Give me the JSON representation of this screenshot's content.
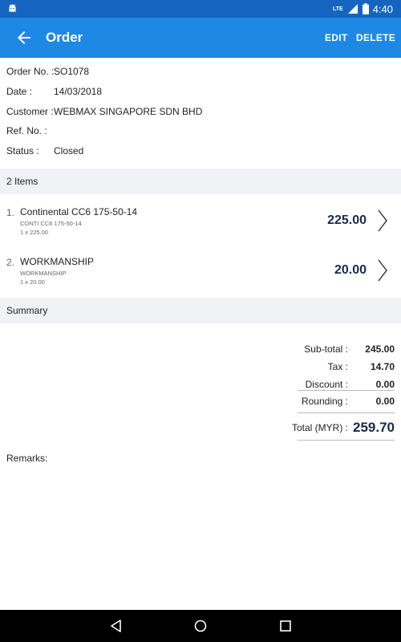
{
  "status_bar": {
    "network": "LTE",
    "time": "4:40"
  },
  "app_bar": {
    "title": "Order",
    "edit_label": "EDIT",
    "delete_label": "DELETE"
  },
  "order": {
    "fields": [
      {
        "label": "Order No. :",
        "value": "SO1078"
      },
      {
        "label": "Date :",
        "value": "14/03/2018"
      },
      {
        "label": "Customer :",
        "value": "WEBMAX SINGAPORE SDN BHD"
      },
      {
        "label": "Ref. No. :",
        "value": ""
      },
      {
        "label": "Status :",
        "value": "Closed"
      }
    ]
  },
  "items_header": "2 Items",
  "items": [
    {
      "index": "1.",
      "name": "Continental CC6 175-50-14",
      "code": "CONTI CC6 175-50-14",
      "qty_price": "1 x 225.00",
      "amount": "225.00"
    },
    {
      "index": "2.",
      "name": "WORKMANSHIP",
      "code": "WORKMANSHIP",
      "qty_price": "1 x 20.00",
      "amount": "20.00"
    }
  ],
  "summary_header": "Summary",
  "summary": {
    "subtotal_label": "Sub-total :",
    "subtotal": "245.00",
    "tax_label": "Tax :",
    "tax": "14.70",
    "discount_label": "Discount :",
    "discount": "0.00",
    "rounding_label": "Rounding :",
    "rounding": "0.00",
    "total_label": "Total (MYR) :",
    "total": "259.70"
  },
  "remarks_label": "Remarks:",
  "colors": {
    "status_bar": "#1565c0",
    "app_bar": "#1e88e5",
    "section_bg": "#f0f2f6",
    "amount_text": "#1a2a4a"
  }
}
